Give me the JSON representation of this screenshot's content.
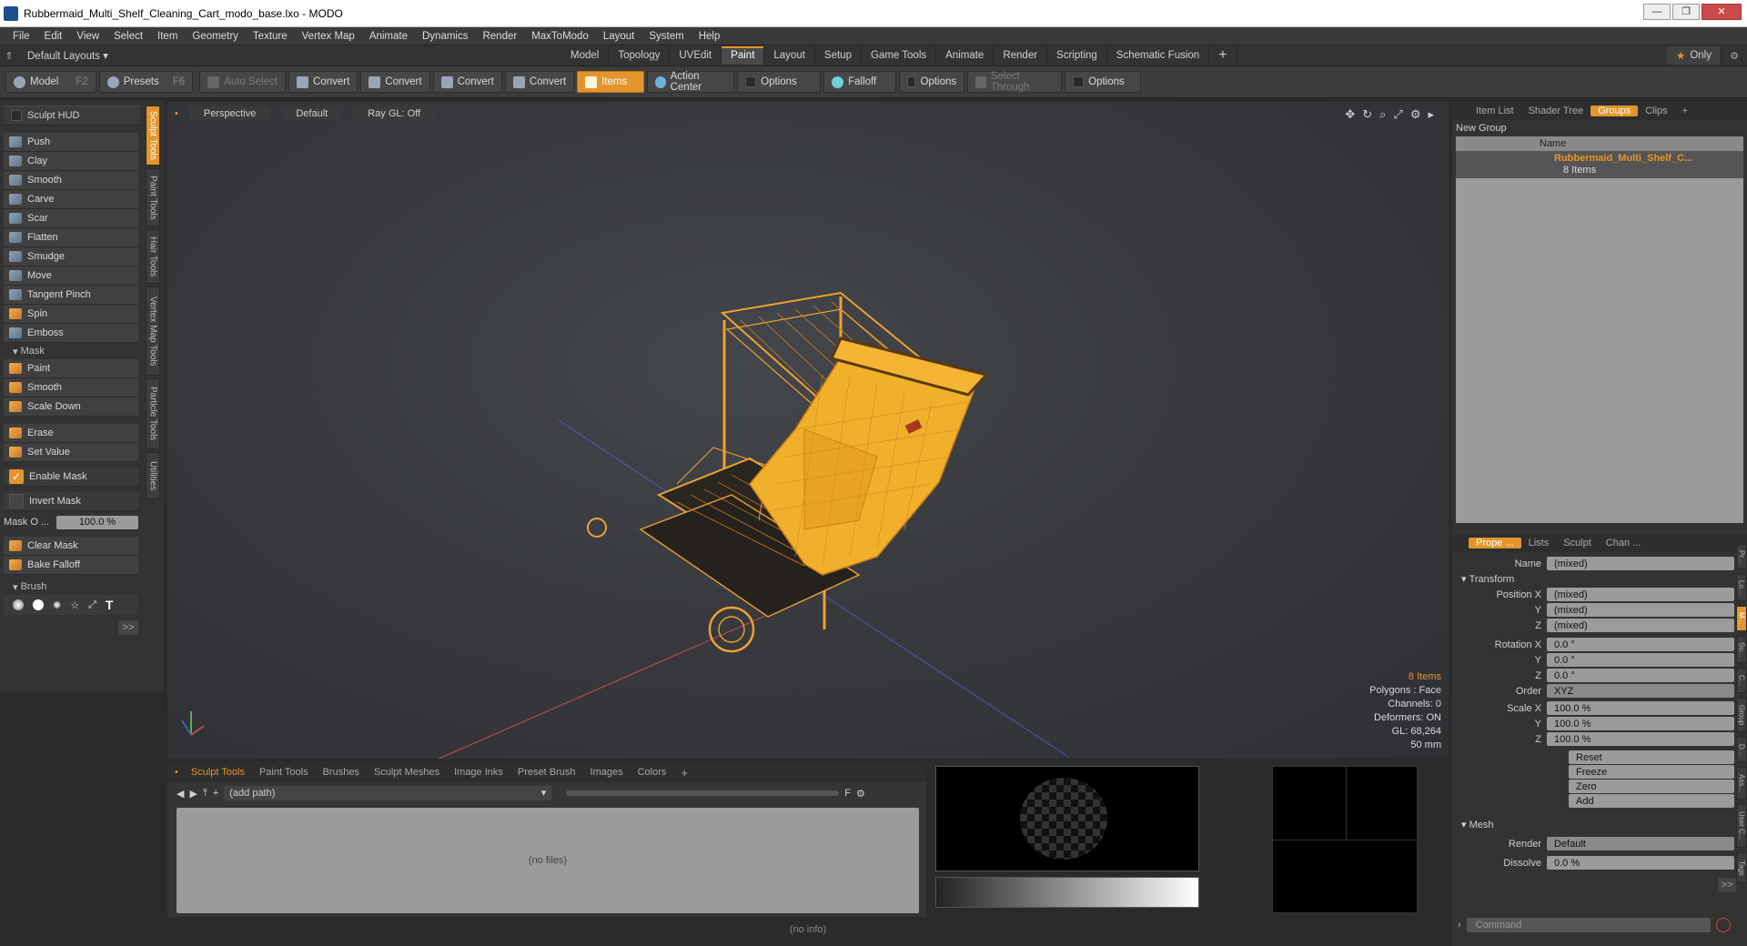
{
  "window": {
    "title": "Rubbermaid_Multi_Shelf_Cleaning_Cart_modo_base.lxo - MODO"
  },
  "menu": [
    "File",
    "Edit",
    "View",
    "Select",
    "Item",
    "Geometry",
    "Texture",
    "Vertex Map",
    "Animate",
    "Dynamics",
    "Render",
    "MaxToModo",
    "Layout",
    "System",
    "Help"
  ],
  "layouts": {
    "default_label": "Default Layouts ▾",
    "tabs": [
      "Model",
      "Topology",
      "UVEdit",
      "Paint",
      "Layout",
      "Setup",
      "Game Tools",
      "Animate",
      "Render",
      "Scripting",
      "Schematic Fusion"
    ],
    "active": "Paint",
    "only_label": "Only"
  },
  "toolbar": {
    "model": "Model",
    "model_key": "F2",
    "presets": "Presets",
    "presets_key": "F6",
    "auto_select": "Auto Select",
    "convert": "Convert",
    "items": "Items",
    "action_center": "Action Center",
    "options": "Options",
    "falloff": "Falloff",
    "select_through": "Select Through"
  },
  "left": {
    "hud": "Sculpt HUD",
    "tools": [
      "Push",
      "Clay",
      "Smooth",
      "Carve",
      "Scar",
      "Flatten",
      "Smudge",
      "Move",
      "Tangent Pinch",
      "Spin",
      "Emboss"
    ],
    "mask_header": "Mask",
    "mask_tools": [
      "Paint",
      "Smooth",
      "Scale Down"
    ],
    "mask_tools2": [
      "Erase",
      "Set Value"
    ],
    "enable_mask": "Enable Mask",
    "invert_mask": "Invert Mask",
    "mask_opacity_label": "Mask O ...",
    "mask_opacity_value": "100.0 %",
    "clear_mask": "Clear Mask",
    "bake_falloff": "Bake Falloff",
    "brush_header": "Brush",
    "more": ">>",
    "vtabs": [
      "Sculpt Tools",
      "Paint Tools",
      "Hair Tools",
      "Vertex Map Tools",
      "Particle Tools",
      "Utilities"
    ]
  },
  "viewport": {
    "view": "Perspective",
    "shading": "Default",
    "raygl": "Ray GL: Off",
    "info": {
      "items": "8 Items",
      "polygons": "Polygons : Face",
      "channels": "Channels: 0",
      "deformers": "Deformers: ON",
      "gl": "GL: 68,264",
      "size": "50 mm"
    }
  },
  "bottom": {
    "tabs": [
      "Sculpt Tools",
      "Paint Tools",
      "Brushes",
      "Sculpt Meshes",
      "Image Inks",
      "Preset Brush",
      "Images",
      "Colors"
    ],
    "path": "(add path)",
    "empty": "(no files)"
  },
  "status": {
    "info": "(no info)"
  },
  "right": {
    "tabs": [
      "Item List",
      "Shader Tree",
      "Groups",
      "Clips"
    ],
    "active": "Groups",
    "new_group": "New Group",
    "col_name": "Name",
    "group_name": "Rubbermaid_Multi_Shelf_C...",
    "group_count": "8 Items",
    "prop_tabs": [
      "Prope ...",
      "Lists",
      "Sculpt",
      "Chan ..."
    ],
    "name_label": "Name",
    "name_value": "(mixed)",
    "transform": "Transform",
    "pos_label": "Position X",
    "pos": [
      "(mixed)",
      "(mixed)",
      "(mixed)"
    ],
    "rot_label": "Rotation X",
    "rot": [
      "0.0 °",
      "0.0 °",
      "0.0 °"
    ],
    "order_label": "Order",
    "order": "XYZ",
    "scale_label": "Scale X",
    "scale": [
      "100.0 %",
      "100.0 %",
      "100.0 %"
    ],
    "axis_y": "Y",
    "axis_z": "Z",
    "buttons": [
      "Reset",
      "Freeze",
      "Zero",
      "Add"
    ],
    "mesh": "Mesh",
    "render_label": "Render",
    "render": "Default",
    "dissolve_label": "Dissolve",
    "dissolve": "0.0 %",
    "more": ">>",
    "command": "Command",
    "side_tabs": [
      "Pr...",
      "Lo...",
      "M...",
      "Su...",
      "C...",
      "Group",
      "D...",
      "Ass...",
      "User C...",
      "Tags"
    ]
  }
}
